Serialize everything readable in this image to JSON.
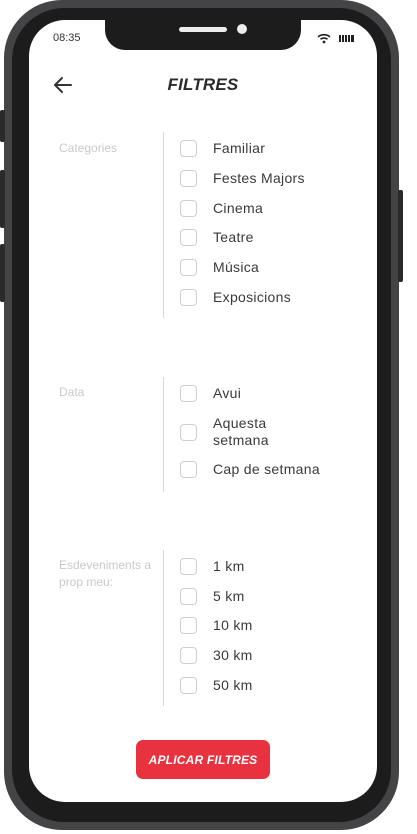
{
  "status_bar": {
    "time": "08:35",
    "icons": [
      "wifi-icon",
      "battery-icon"
    ]
  },
  "header": {
    "title": "FILTRES",
    "back_icon": "arrow-left-icon"
  },
  "sections": [
    {
      "label": "Categories",
      "options": [
        "Familiar",
        "Festes Majors",
        "Cinema",
        "Teatre",
        "Música",
        "Exposicions"
      ]
    },
    {
      "label": "Data",
      "options": [
        "Avui",
        "Aquesta setmana",
        "Cap de setmana"
      ]
    },
    {
      "label": "Esdeveniments a prop meu:",
      "options": [
        "1 km",
        "5 km",
        "10 km",
        "30 km",
        "50 km"
      ]
    }
  ],
  "apply_button": {
    "label": "APLICAR FILTRES"
  },
  "colors": {
    "accent": "#e8323f",
    "frame": "#444446",
    "label_gray": "#c9c9c9"
  }
}
